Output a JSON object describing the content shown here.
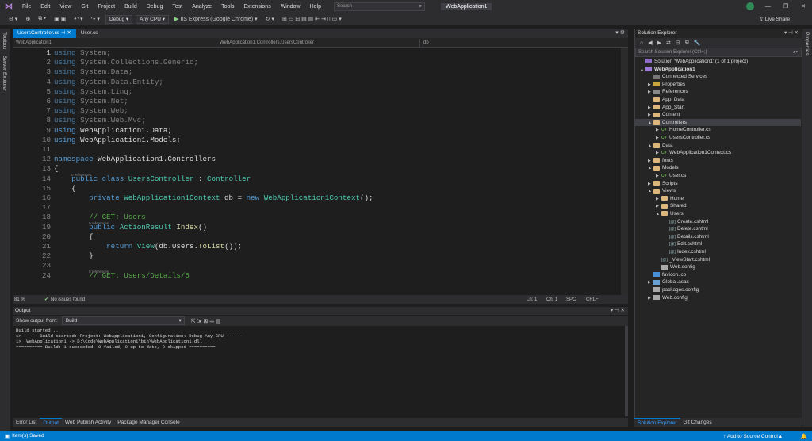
{
  "menu": [
    "File",
    "Edit",
    "View",
    "Git",
    "Project",
    "Build",
    "Debug",
    "Test",
    "Analyze",
    "Tools",
    "Extensions",
    "Window",
    "Help"
  ],
  "search_placeholder": "Search",
  "window_title": "WebApplication1",
  "live_share": "Live Share",
  "toolbar": {
    "config": "Debug",
    "platform": "Any CPU",
    "run_target": "IIS Express (Google Chrome)"
  },
  "left_tabs": [
    "Toolbox",
    "Server Explorer"
  ],
  "right_tabs": [
    "Properties"
  ],
  "doc_tabs": [
    "UsersController.cs",
    "User.cs"
  ],
  "nav": {
    "project": "WebApplication1",
    "class": "WebApplication1.Controllers.UsersController",
    "member": "db"
  },
  "code": {
    "lines": [
      {
        "n": "1",
        "t": "using System;"
      },
      {
        "n": "2",
        "t": "using System.Collections.Generic;"
      },
      {
        "n": "3",
        "t": "using System.Data;"
      },
      {
        "n": "4",
        "t": "using System.Data.Entity;"
      },
      {
        "n": "5",
        "t": "using System.Linq;"
      },
      {
        "n": "6",
        "t": "using System.Net;"
      },
      {
        "n": "7",
        "t": "using System.Web;"
      },
      {
        "n": "8",
        "t": "using System.Web.Mvc;"
      },
      {
        "n": "9",
        "t": "using WebApplication1.Data;"
      },
      {
        "n": "10",
        "t": "using WebApplication1.Models;"
      },
      {
        "n": "11",
        "t": ""
      },
      {
        "n": "12",
        "t": "namespace WebApplication1.Controllers"
      },
      {
        "n": "13",
        "t": "{"
      },
      {
        "n": "14",
        "t": "    public class UsersController : Controller"
      },
      {
        "n": "15",
        "t": "    {"
      },
      {
        "n": "16",
        "t": "        private WebApplication1Context db = new WebApplication1Context();"
      },
      {
        "n": "17",
        "t": ""
      },
      {
        "n": "18",
        "t": "        // GET: Users"
      },
      {
        "n": "19",
        "t": "        public ActionResult Index()"
      },
      {
        "n": "20",
        "t": "        {"
      },
      {
        "n": "21",
        "t": "            return View(db.Users.ToList());"
      },
      {
        "n": "22",
        "t": "        }"
      },
      {
        "n": "23",
        "t": ""
      },
      {
        "n": "24",
        "t": "        // GET: Users/Details/5"
      }
    ],
    "refs": "0 references"
  },
  "editor_status": {
    "zoom": "81 %",
    "issues": "No issues found",
    "ln": "Ln: 1",
    "ch": "Ch: 1",
    "spc": "SPC",
    "crlf": "CRLF"
  },
  "output": {
    "title": "Output",
    "show_from_label": "Show output from:",
    "source": "Build",
    "lines": [
      "Build started...",
      "1>------ Build started: Project: WebApplication1, Configuration: Debug Any CPU ------",
      "1>  WebApplication1 -> D:\\Code\\WebApplication1\\bin\\WebApplication1.dll",
      "========== Build: 1 succeeded, 0 failed, 0 up-to-date, 0 skipped =========="
    ]
  },
  "bottom_tabs": [
    "Error List",
    "Output",
    "Web Publish Activity",
    "Package Manager Console"
  ],
  "solution": {
    "title": "Solution Explorer",
    "search_placeholder": "Search Solution Explorer (Ctrl+;)",
    "tree": [
      {
        "label": "Solution 'WebApplication1' (1 of 1 project)",
        "d": 0,
        "k": "sln",
        "a": ""
      },
      {
        "label": "WebApplication1",
        "d": 0,
        "k": "proj",
        "a": "▲"
      },
      {
        "label": "Connected Services",
        "d": 1,
        "k": "svc",
        "a": ""
      },
      {
        "label": "Properties",
        "d": 1,
        "k": "prop",
        "a": "▶"
      },
      {
        "label": "References",
        "d": 1,
        "k": "ref",
        "a": "▶"
      },
      {
        "label": "App_Data",
        "d": 1,
        "k": "folder",
        "a": ""
      },
      {
        "label": "App_Start",
        "d": 1,
        "k": "folder",
        "a": "▶"
      },
      {
        "label": "Content",
        "d": 1,
        "k": "folder",
        "a": "▶"
      },
      {
        "label": "Controllers",
        "d": 1,
        "k": "folder",
        "a": "▲",
        "sel": true
      },
      {
        "label": "HomeController.cs",
        "d": 2,
        "k": "cs",
        "a": "▶"
      },
      {
        "label": "UsersController.cs",
        "d": 2,
        "k": "cs",
        "a": "▶"
      },
      {
        "label": "Data",
        "d": 1,
        "k": "folder",
        "a": "▲"
      },
      {
        "label": "WebApplication1Context.cs",
        "d": 2,
        "k": "cs",
        "a": "▶"
      },
      {
        "label": "fonts",
        "d": 1,
        "k": "folder",
        "a": "▶"
      },
      {
        "label": "Models",
        "d": 1,
        "k": "folder",
        "a": "▲"
      },
      {
        "label": "User.cs",
        "d": 2,
        "k": "cs",
        "a": "▶"
      },
      {
        "label": "Scripts",
        "d": 1,
        "k": "folder",
        "a": "▶"
      },
      {
        "label": "Views",
        "d": 1,
        "k": "folder",
        "a": "▲"
      },
      {
        "label": "Home",
        "d": 2,
        "k": "folder",
        "a": "▶"
      },
      {
        "label": "Shared",
        "d": 2,
        "k": "folder",
        "a": "▶"
      },
      {
        "label": "Users",
        "d": 2,
        "k": "folder",
        "a": "▲"
      },
      {
        "label": "Create.cshtml",
        "d": 3,
        "k": "cshtml",
        "a": ""
      },
      {
        "label": "Delete.cshtml",
        "d": 3,
        "k": "cshtml",
        "a": ""
      },
      {
        "label": "Details.cshtml",
        "d": 3,
        "k": "cshtml",
        "a": ""
      },
      {
        "label": "Edit.cshtml",
        "d": 3,
        "k": "cshtml",
        "a": ""
      },
      {
        "label": "Index.cshtml",
        "d": 3,
        "k": "cshtml",
        "a": ""
      },
      {
        "label": "_ViewStart.cshtml",
        "d": 2,
        "k": "cshtml",
        "a": ""
      },
      {
        "label": "Web.config",
        "d": 2,
        "k": "config",
        "a": ""
      },
      {
        "label": "favicon.ico",
        "d": 1,
        "k": "ico",
        "a": ""
      },
      {
        "label": "Global.asax",
        "d": 1,
        "k": "asax",
        "a": "▶"
      },
      {
        "label": "packages.config",
        "d": 1,
        "k": "config",
        "a": ""
      },
      {
        "label": "Web.config",
        "d": 1,
        "k": "config",
        "a": "▶"
      }
    ]
  },
  "sol_tabs": [
    "Solution Explorer",
    "Git Changes"
  ],
  "status": {
    "left": "Item(s) Saved",
    "right": "Add to Source Control"
  },
  "colors": {
    "accent": "#007acc",
    "bg": "#1e1e1e",
    "chrome": "#2d2d30"
  }
}
